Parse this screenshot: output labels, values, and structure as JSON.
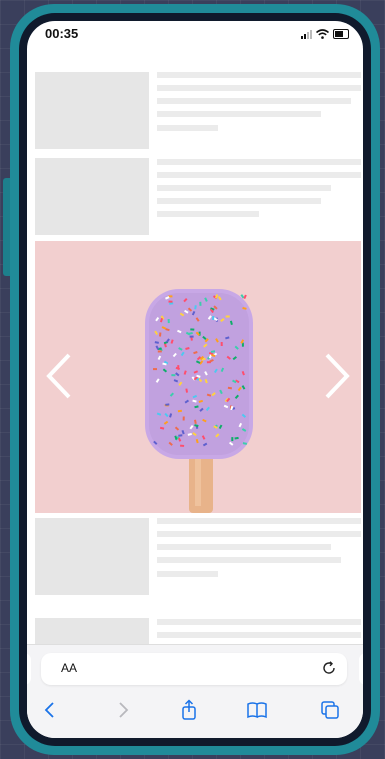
{
  "status_bar": {
    "time": "00:35",
    "icons": [
      "signal-icon",
      "wifi-icon",
      "battery-icon"
    ]
  },
  "carousel": {
    "image": "popsicle-with-sprinkles",
    "prev_icon": "chevron-left-icon",
    "next_icon": "chevron-right-icon",
    "background_color": "#f2cfcf"
  },
  "address_bar": {
    "text_size_label": "AA",
    "reload_icon": "reload-icon"
  },
  "toolbar": {
    "buttons": [
      "back-icon",
      "forward-icon",
      "share-icon",
      "bookmarks-icon",
      "tabs-icon"
    ],
    "accent_color": "#1a73e8"
  },
  "colors": {
    "device_frame": "#208b99",
    "bezel": "#101a2c",
    "placeholder": "#e6e6e6"
  }
}
